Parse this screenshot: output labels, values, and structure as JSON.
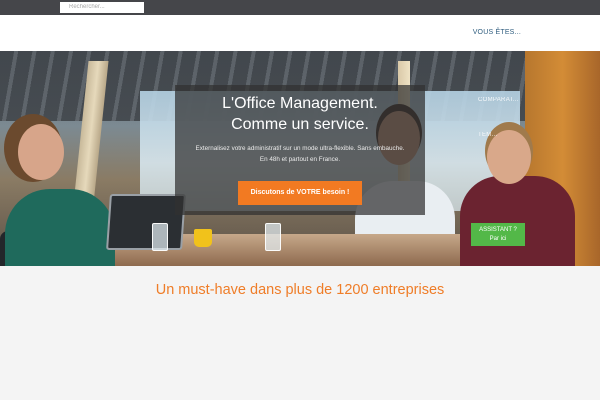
{
  "search": {
    "placeholder": "Rechercher..."
  },
  "nav": {
    "menu_label": "VOUS ÊTES..."
  },
  "hero": {
    "title_line1": "L'Office Management.",
    "title_line2": "Comme un service.",
    "description_line1": "Externalisez votre administratif sur un mode ultra-flexible. Sans embauche.",
    "description_line2": "En 48h et partout en France.",
    "cta_label": "Discutons de VOTRE besoin !",
    "side_tabs": [
      "COMPARAT...",
      "TEM..."
    ],
    "assistant_line1": "ASSISTANT ?",
    "assistant_line2": "Par ici"
  },
  "tagline": "Un must-have dans plus de 1200 entreprises",
  "colors": {
    "topbar": "#45464a",
    "accent_orange": "#f27a22",
    "assistant_green": "#53b848",
    "nav_link": "#2f5d7f"
  },
  "icons": []
}
